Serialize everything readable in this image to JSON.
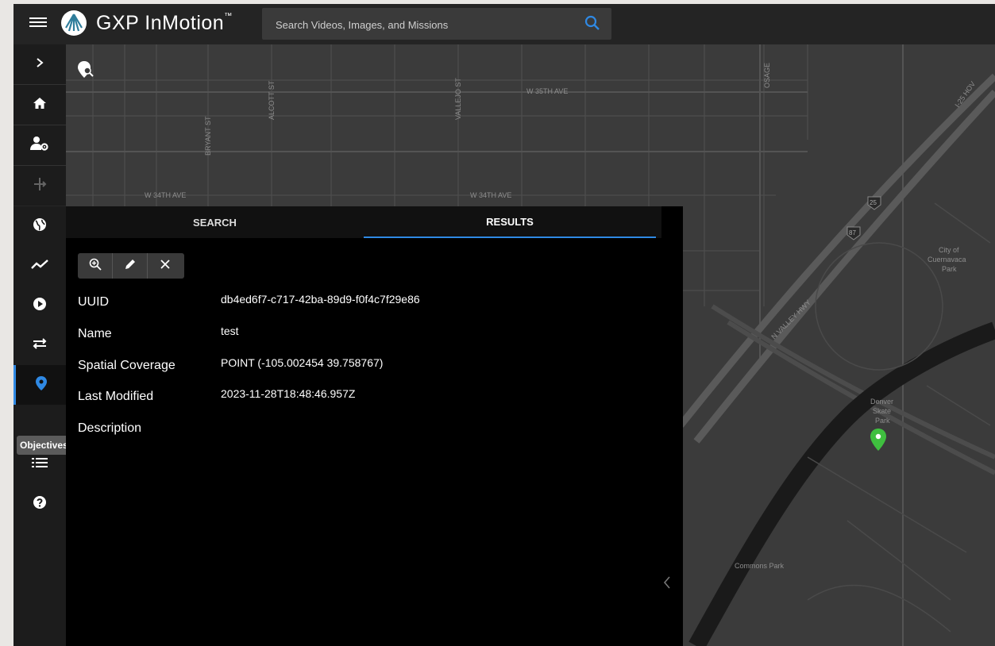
{
  "app": {
    "brand": "GXP InMotion",
    "trademark": "™"
  },
  "search": {
    "placeholder": "Search Videos, Images, and Missions"
  },
  "rail": {
    "items": [
      {
        "name": "expand",
        "icon": "chevron-right-icon"
      },
      {
        "name": "home",
        "icon": "home-icon"
      },
      {
        "name": "user-admin",
        "icon": "user-settings-icon"
      },
      {
        "name": "analytics-disabled",
        "icon": "split-icon"
      },
      {
        "name": "globe",
        "icon": "globe-icon"
      },
      {
        "name": "trends",
        "icon": "trend-line-icon"
      },
      {
        "name": "play",
        "icon": "play-icon"
      },
      {
        "name": "transfer",
        "icon": "swap-arrows-icon"
      },
      {
        "name": "objectives",
        "icon": "map-pin-icon"
      },
      {
        "name": "hidden",
        "icon": "hidden-icon"
      },
      {
        "name": "list",
        "icon": "list-icon"
      },
      {
        "name": "help",
        "icon": "help-icon"
      }
    ],
    "tooltip": "Objectives"
  },
  "panel": {
    "tabs": [
      {
        "label": "SEARCH"
      },
      {
        "label": "RESULTS"
      }
    ],
    "active_tab": "RESULTS",
    "fields": [
      {
        "label": "UUID",
        "value": "db4ed6f7-c717-42ba-89d9-f0f4c7f29e86"
      },
      {
        "label": "Name",
        "value": "test"
      },
      {
        "label": "Spatial Coverage",
        "value": "POINT (-105.002454 39.758767)"
      },
      {
        "label": "Last Modified",
        "value": "2023-11-28T18:48:46.957Z"
      },
      {
        "label": "Description",
        "value": ""
      }
    ]
  },
  "map": {
    "labels": {
      "w35": "W 35TH AVE",
      "w34a": "W 34TH AVE",
      "w34b": "W 34TH AVE",
      "bryant": "BRYANT ST",
      "alcott": "ALCOTT ST",
      "vallejo": "VALLEJO ST",
      "osage": "OSAGE",
      "nvalley": "N VALLEY HWY",
      "i25": "I-25 HOV",
      "cuernavaca_1": "City of",
      "cuernavaca_2": "Cuernavaca",
      "cuernavaca_3": "Park",
      "skate_1": "Denver",
      "skate_2": "Skate",
      "skate_3": "Park",
      "commons": "Commons Park",
      "shield25": "25",
      "shield87": "87"
    },
    "marker_color": "#3fbf3f"
  },
  "colors": {
    "accent": "#2f89e4",
    "topbar": "#242424"
  }
}
